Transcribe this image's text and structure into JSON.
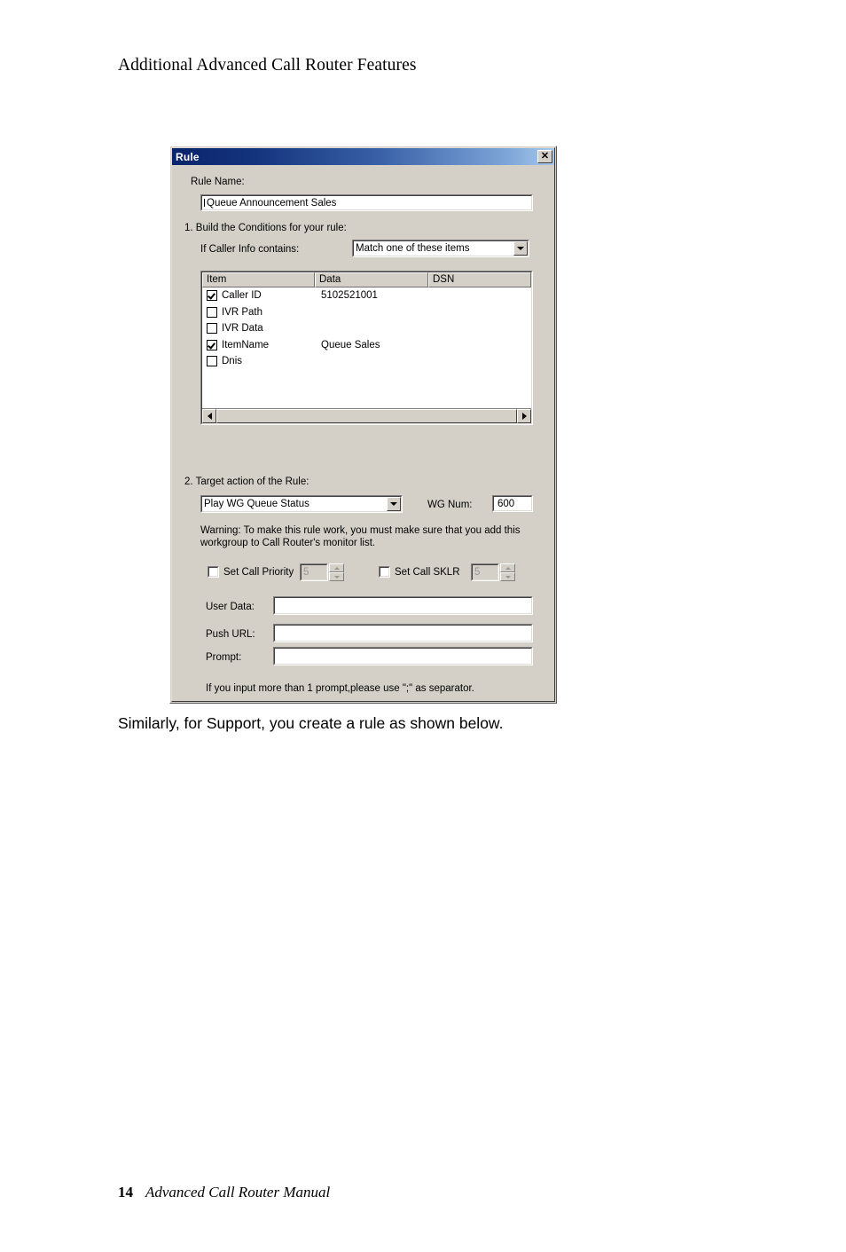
{
  "page": {
    "header": "Additional Advanced Call Router Features",
    "body_text": "Similarly, for Support, you create a rule as shown below.",
    "footer_page_number": "14",
    "footer_manual_title": "Advanced Call Router Manual"
  },
  "dialog": {
    "title": "Rule",
    "close_label": "✕",
    "rule_name_label": "Rule Name:",
    "rule_name_value": "Queue Announcement Sales",
    "step1_label": "1. Build the Conditions for your rule:",
    "caller_info_label": "If Caller Info contains:",
    "caller_info_value": "Match one of these items",
    "conditions": {
      "columns": [
        "Item",
        "Data",
        "DSN"
      ],
      "rows": [
        {
          "checked": true,
          "item": "Caller ID",
          "data": "5102521001",
          "dsn": ""
        },
        {
          "checked": false,
          "item": "IVR Path",
          "data": "",
          "dsn": ""
        },
        {
          "checked": false,
          "item": "IVR Data",
          "data": "",
          "dsn": ""
        },
        {
          "checked": true,
          "item": "ItemName",
          "data": "Queue Sales",
          "dsn": ""
        },
        {
          "checked": false,
          "item": "Dnis",
          "data": "",
          "dsn": ""
        }
      ]
    },
    "step2_label": "2. Target action of the Rule:",
    "target_action_value": "Play WG Queue Status",
    "wg_num_label": "WG Num:",
    "wg_num_value": "600",
    "warning_text": "Warning: To make this rule work, you must make sure that you add this workgroup to Call Router's monitor list.",
    "set_call_priority_label": "Set Call Priority",
    "set_call_priority_value": "5",
    "set_call_priority_checked": false,
    "set_call_sklr_label": "Set Call SKLR",
    "set_call_sklr_value": "5",
    "set_call_sklr_checked": false,
    "user_data_label": "User Data:",
    "user_data_value": "",
    "push_url_label": "Push URL:",
    "push_url_value": "",
    "prompt_label": "Prompt:",
    "prompt_value": "",
    "prompt_note": "If you input more than 1 prompt,please use \";\" as separator.",
    "colors": {
      "dialog_face": "#d4d0c8",
      "titlebar_start": "#0a246a",
      "titlebar_end": "#a6c8ea",
      "field_bg": "#ffffff",
      "disabled_text": "#9a9690"
    }
  }
}
